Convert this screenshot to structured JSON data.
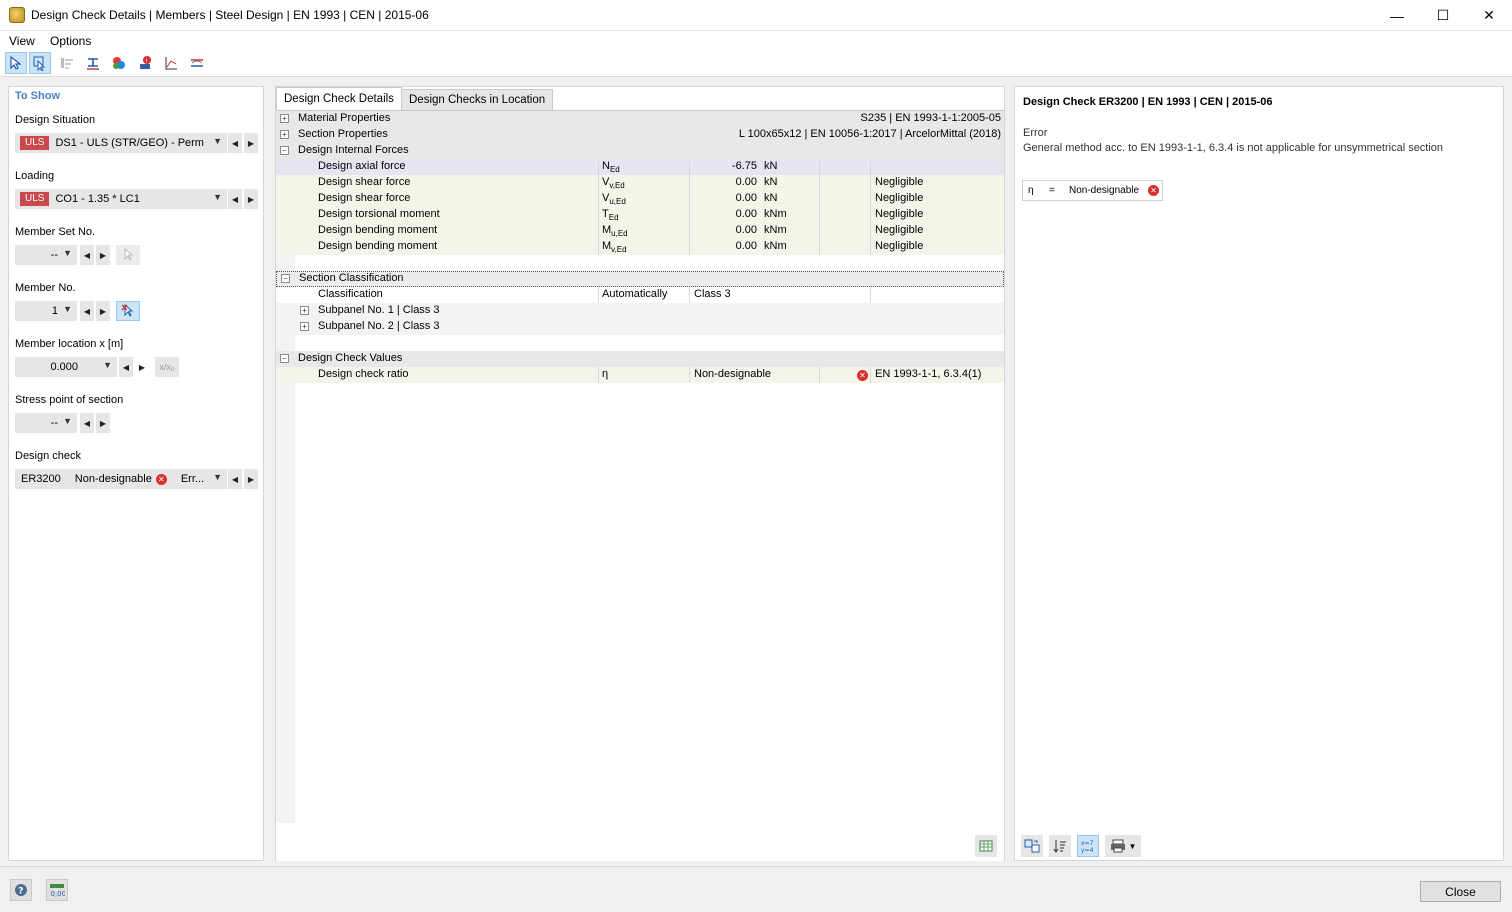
{
  "window": {
    "title": "Design Check Details | Members | Steel Design | EN 1993 | CEN | 2015-06",
    "minimize": "—",
    "maximize": "☐",
    "close": "✕"
  },
  "menu": [
    "View",
    "Options"
  ],
  "toolbar": {
    "icons": [
      "select-member-icon",
      "select-location-icon",
      "align-icon",
      "section-icon",
      "color-legend-icon",
      "info-marker-icon",
      "diagram-icon",
      "member-diagram-icon"
    ]
  },
  "left": {
    "header": "To Show",
    "design_situation": {
      "label": "Design Situation",
      "badge": "ULS",
      "value": "DS1 - ULS (STR/GEO) - Perm..."
    },
    "loading": {
      "label": "Loading",
      "badge": "ULS",
      "value": "CO1 - 1.35 * LC1"
    },
    "member_set": {
      "label": "Member Set No.",
      "value": "--"
    },
    "member": {
      "label": "Member No.",
      "value": "1"
    },
    "location": {
      "label": "Member location x [m]",
      "value": "0.000",
      "rel": "x/x₀"
    },
    "stress_point": {
      "label": "Stress point of section",
      "value": "--"
    },
    "design_check": {
      "label": "Design check",
      "code": "ER3200",
      "result": "Non-designable",
      "type": "Err..."
    }
  },
  "center": {
    "tabs": [
      "Design Check Details",
      "Design Checks in Location"
    ],
    "groups": {
      "material": {
        "label": "Material Properties",
        "value": "S235 | EN 1993-1-1:2005-05"
      },
      "section": {
        "label": "Section Properties",
        "value": "L 100x65x12 | EN 10056-1:2017 | ArcelorMittal (2018)"
      },
      "forces": {
        "label": "Design Internal Forces"
      },
      "classification": {
        "label": "Section Classification"
      },
      "check_values": {
        "label": "Design Check Values"
      }
    },
    "forces": [
      {
        "name": "Design axial force",
        "sym": "N",
        "sub": "Ed",
        "value": "-6.75",
        "unit": "kN",
        "note": ""
      },
      {
        "name": "Design shear force",
        "sym": "V",
        "sub": "v,Ed",
        "value": "0.00",
        "unit": "kN",
        "note": "Negligible"
      },
      {
        "name": "Design shear force",
        "sym": "V",
        "sub": "u,Ed",
        "value": "0.00",
        "unit": "kN",
        "note": "Negligible"
      },
      {
        "name": "Design torsional moment",
        "sym": "T",
        "sub": "Ed",
        "value": "0.00",
        "unit": "kNm",
        "note": "Negligible"
      },
      {
        "name": "Design bending moment",
        "sym": "M",
        "sub": "u,Ed",
        "value": "0.00",
        "unit": "kNm",
        "note": "Negligible"
      },
      {
        "name": "Design bending moment",
        "sym": "M",
        "sub": "v,Ed",
        "value": "0.00",
        "unit": "kNm",
        "note": "Negligible"
      }
    ],
    "classification": {
      "name": "Classification",
      "method": "Automatically",
      "value": "Class 3"
    },
    "subpanels": [
      "Subpanel No. 1 | Class 3",
      "Subpanel No. 2 | Class 3"
    ],
    "check_ratio": {
      "name": "Design check ratio",
      "sym": "η",
      "value": "Non-designable",
      "ref": "EN 1993-1-1, 6.3.4(1)"
    }
  },
  "right": {
    "title": "Design Check ER3200 | EN 1993 | CEN | 2015-06",
    "error_label": "Error",
    "error_text": "General method acc. to EN 1993-1-1, 6.3.4 is not applicable for unsymmetrical section",
    "eta_sym": "η",
    "eta_eq": "=",
    "eta_value": "Non-designable"
  },
  "bottom": {
    "close": "Close"
  },
  "colors": {
    "uls_badge": "#c9494d",
    "header_blue": "#4b80c0",
    "error_red": "#d8302c"
  }
}
